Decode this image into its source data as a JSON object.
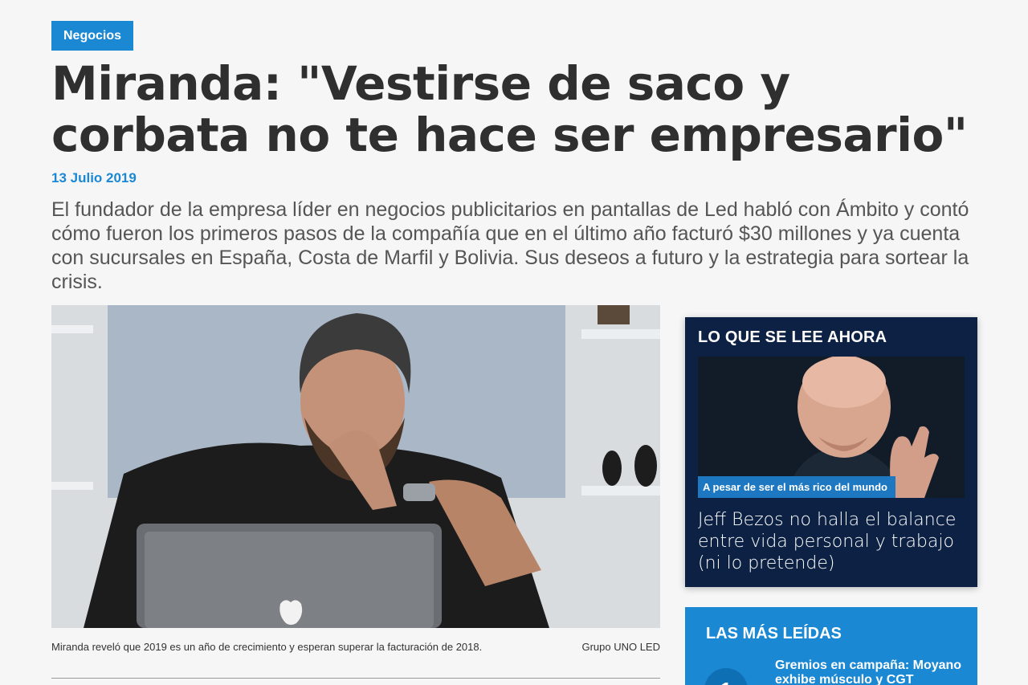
{
  "article": {
    "category": "Negocios",
    "headline": "Miranda: \"Vestirse de saco y corbata no te hace ser empresario\"",
    "date": "13 Julio 2019",
    "lead": "El fundador de la empresa líder en negocios publicitarios en pantallas de Led habló con Ámbito y contó cómo fueron los primeros pasos de la compañía que en el último año facturó $30 millones y ya cuenta con sucursales en España, Costa de Marfil y Bolivia. Sus deseos a futuro y la estrategia para sortear la crisis.",
    "caption": "Miranda reveló que 2019 es un año de crecimiento y esperan superar la facturación de 2018.",
    "credit": "Grupo UNO LED"
  },
  "sidebar": {
    "trending": {
      "title": "LO QUE SE LEE AHORA",
      "kicker": "A pesar de ser el más rico del mundo",
      "headline": "Jeff Bezos no halla el balance entre vida personal y trabajo (ni lo pretende)"
    },
    "most_read": {
      "title": "LAS MÁS LEÍDAS",
      "items": [
        {
          "rank": "1",
          "headline": "Gremios en campaña: Moyano exhibe músculo y CGT"
        }
      ]
    }
  },
  "colors": {
    "accent": "#1b88d3",
    "trending_bg": "#0c2143"
  }
}
